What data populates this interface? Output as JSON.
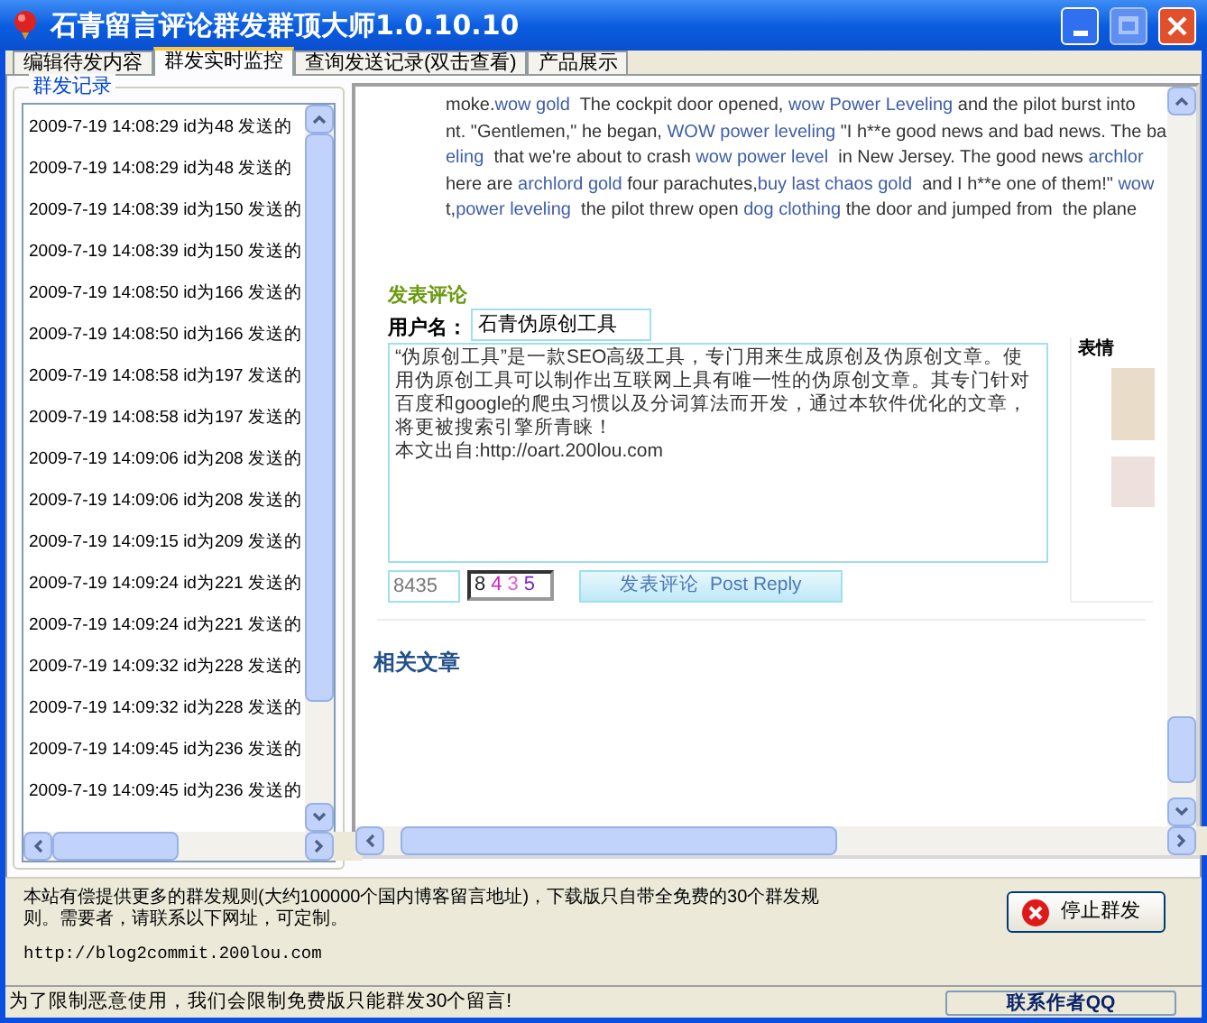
{
  "window": {
    "title": "石青留言评论群发群顶大师1.0.10.10"
  },
  "tabs": [
    {
      "label": "编辑待发内容",
      "selected": false
    },
    {
      "label": "群发实时监控",
      "selected": true
    },
    {
      "label": "查询发送记录(双击查看)",
      "selected": false
    },
    {
      "label": "产品展示",
      "selected": false
    }
  ],
  "log_panel": {
    "title": "群发记录",
    "rows": [
      "2009-7-19 14:08:29 id为48 发送的",
      "2009-7-19 14:08:29 id为48 发送的",
      "2009-7-19 14:08:39 id为150 发送的",
      "2009-7-19 14:08:39 id为150 发送的",
      "2009-7-19 14:08:50 id为166 发送的",
      "2009-7-19 14:08:50 id为166 发送的",
      "2009-7-19 14:08:58 id为197 发送的",
      "2009-7-19 14:08:58 id为197 发送的",
      "2009-7-19 14:09:06 id为208 发送的",
      "2009-7-19 14:09:06 id为208 发送的",
      "2009-7-19 14:09:15 id为209 发送的",
      "2009-7-19 14:09:24 id为221 发送的",
      "2009-7-19 14:09:24 id为221 发送的",
      "2009-7-19 14:09:32 id为228 发送的",
      "2009-7-19 14:09:32 id为228 发送的",
      "2009-7-19 14:09:45 id为236 发送的",
      "2009-7-19 14:09:45 id为236 发送的"
    ]
  },
  "browser": {
    "article_lines": [
      [
        {
          "kind": "text",
          "text": "moke."
        },
        {
          "kind": "link",
          "text": "wow gold"
        },
        {
          "kind": "text",
          "text": "  The cockpit door opened, "
        },
        {
          "kind": "link",
          "text": "wow Power Leveling"
        },
        {
          "kind": "text",
          "text": " and the pilot burst into"
        }
      ],
      [
        {
          "kind": "text",
          "text": "nt. \"Gentlemen,\" he began, "
        },
        {
          "kind": "link",
          "text": "WOW power leveling"
        },
        {
          "kind": "text",
          "text": " \"I h**e good news and bad news. The ba"
        }
      ],
      [
        {
          "kind": "link",
          "text": "eling"
        },
        {
          "kind": "text",
          "text": "  that we're about to crash "
        },
        {
          "kind": "link",
          "text": "wow power level"
        },
        {
          "kind": "text",
          "text": "  in New Jersey. The good news "
        },
        {
          "kind": "link",
          "text": "archlor"
        }
      ],
      [
        {
          "kind": "text",
          "text": "here are "
        },
        {
          "kind": "link",
          "text": "archlord gold"
        },
        {
          "kind": "text",
          "text": " four parachutes,"
        },
        {
          "kind": "link",
          "text": "buy last chaos gold"
        },
        {
          "kind": "text",
          "text": "  and I h**e one of them!\" "
        },
        {
          "kind": "link",
          "text": "wow"
        }
      ],
      [
        {
          "kind": "text",
          "text": "t,"
        },
        {
          "kind": "link",
          "text": "power leveling"
        },
        {
          "kind": "text",
          "text": "  the pilot threw open "
        },
        {
          "kind": "link",
          "text": "dog clothing"
        },
        {
          "kind": "text",
          "text": " the door and jumped from  the plane"
        }
      ]
    ],
    "comment_heading": "发表评论",
    "username_label": "用户名：",
    "username_value": "石青伪原创工具",
    "comment_lines": [
      "“伪原创工具”是一款SEO高级工具，专门用来生成原创及伪原创文章。使用伪原创工具可以制作出互联网上具有唯一性的伪原创文章。其专门针对百度和google的爬虫习惯以及分词算法而开发，通过本软件优化的文章，将更被搜索引擎所青睐！",
      "本文出自:http://oart.200lou.com"
    ],
    "emoticons_label": "表情",
    "captcha_value": "8435",
    "captcha_image": "8435",
    "post_button": "发表评论  Post Reply",
    "related_heading": "相关文章"
  },
  "notice": {
    "text": "本站有偿提供更多的群发规则(大约100000个国内博客留言地址)，下载版只自带全免费的30个群发规则。需要者，请联系以下网址，可定制。",
    "url": "http://blog2commit.200lou.com"
  },
  "stop_button": "停止群发",
  "status_bar": {
    "message": "为了限制恶意使用，我们会限制免费版只能群发30个留言!",
    "contact": "联系作者QQ"
  }
}
